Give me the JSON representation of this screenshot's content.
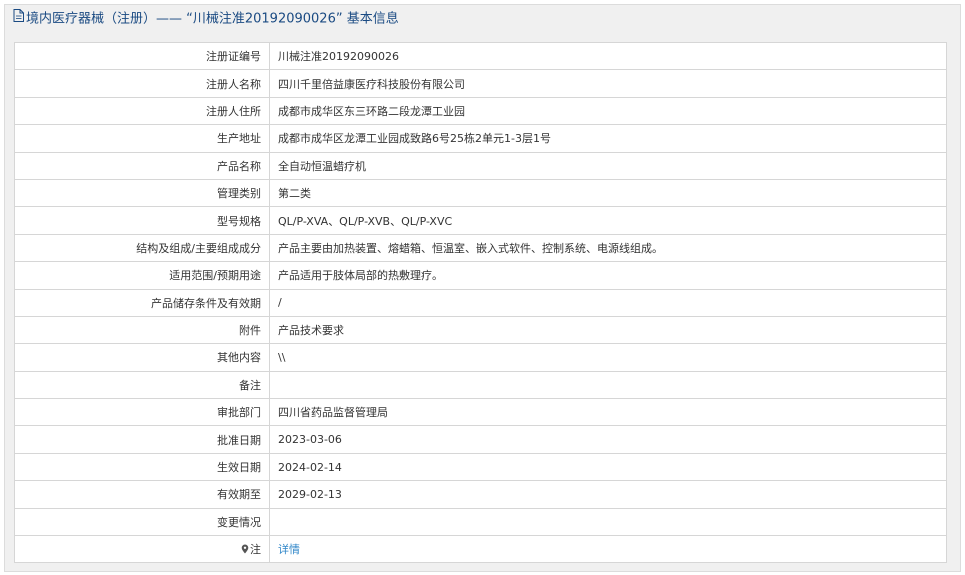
{
  "header": {
    "title": "境内医疗器械（注册）—— “川械注准20192090026” 基本信息"
  },
  "rows": [
    {
      "label": "注册证编号",
      "value": "川械注准20192090026"
    },
    {
      "label": "注册人名称",
      "value": "四川千里倍益康医疗科技股份有限公司"
    },
    {
      "label": "注册人住所",
      "value": "成都市成华区东三环路二段龙潭工业园"
    },
    {
      "label": "生产地址",
      "value": "成都市成华区龙潭工业园成致路6号25栋2单元1-3层1号"
    },
    {
      "label": "产品名称",
      "value": "全自动恒温蜡疗机"
    },
    {
      "label": "管理类别",
      "value": "第二类"
    },
    {
      "label": "型号规格",
      "value": "QL/P-XVA、QL/P-XVB、QL/P-XVC"
    },
    {
      "label": "结构及组成/主要组成成分",
      "value": "产品主要由加热装置、熔蜡箱、恒温室、嵌入式软件、控制系统、电源线组成。"
    },
    {
      "label": "适用范围/预期用途",
      "value": "产品适用于肢体局部的热敷理疗。"
    },
    {
      "label": "产品储存条件及有效期",
      "value": "/"
    },
    {
      "label": "附件",
      "value": "产品技术要求"
    },
    {
      "label": "其他内容",
      "value": "\\\\"
    },
    {
      "label": "备注",
      "value": ""
    },
    {
      "label": "审批部门",
      "value": "四川省药品监督管理局"
    },
    {
      "label": "批准日期",
      "value": "2023-03-06"
    },
    {
      "label": "生效日期",
      "value": "2024-02-14"
    },
    {
      "label": "有效期至",
      "value": "2029-02-13"
    },
    {
      "label": "变更情况",
      "value": ""
    }
  ],
  "note_row": {
    "label": "注",
    "icon": "pin-icon",
    "link_text": "详情"
  },
  "colors": {
    "title": "#1a4a82",
    "link": "#2f86c8",
    "border": "#d6d6d6",
    "panel_bg": "#f0f0f0"
  }
}
